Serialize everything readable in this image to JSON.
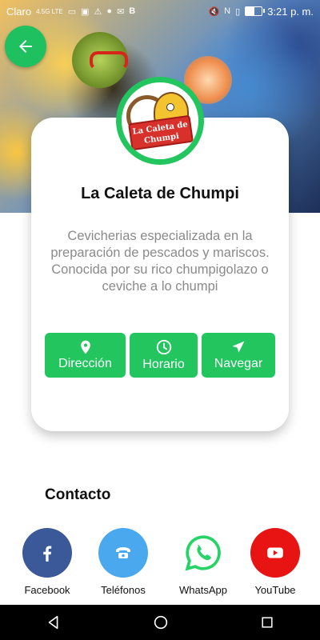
{
  "status_bar": {
    "carrier": "Claro",
    "network": "4.5G LTE",
    "time": "3:21 p. m."
  },
  "restaurant": {
    "name": "La Caleta de Chumpi",
    "description": "Cevicherias especializada en la preparación de pescados y mariscos. Conocida por su rico chumpigolazo o ceviche a lo chumpi",
    "logo_text_line1": "La Caleta de",
    "logo_text_line2": "Chumpi"
  },
  "actions": [
    {
      "label": "Dirección",
      "icon": "location-pin-icon"
    },
    {
      "label": "Horario",
      "icon": "clock-icon"
    },
    {
      "label": "Navegar",
      "icon": "navigation-arrow-icon"
    }
  ],
  "contact": {
    "title": "Contacto",
    "items": [
      {
        "label": "Facebook",
        "icon": "facebook-icon",
        "color": "#3b5998"
      },
      {
        "label": "Teléfonos",
        "icon": "phone-icon",
        "color": "#4aa8ee"
      },
      {
        "label": "WhatsApp",
        "icon": "whatsapp-icon",
        "color": "#25d366"
      },
      {
        "label": "YouTube",
        "icon": "youtube-icon",
        "color": "#e81313"
      }
    ]
  },
  "colors": {
    "accent": "#22c55e",
    "nav_bar": "#000000"
  }
}
